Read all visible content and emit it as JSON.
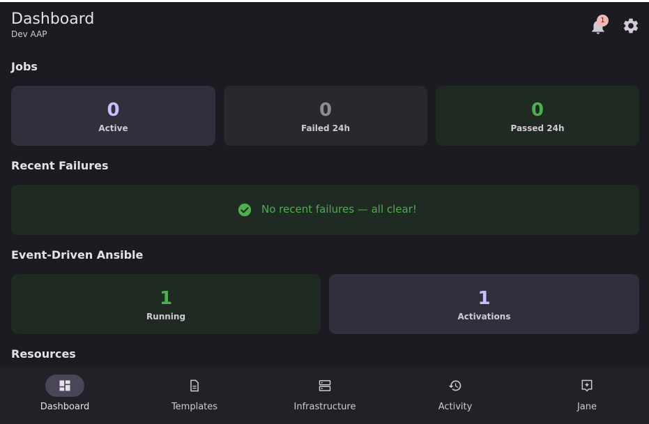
{
  "header": {
    "title": "Dashboard",
    "subtitle": "Dev AAP",
    "notification_count": "1"
  },
  "jobs": {
    "section_title": "Jobs",
    "cards": [
      {
        "value": "0",
        "label": "Active"
      },
      {
        "value": "0",
        "label": "Failed 24h"
      },
      {
        "value": "0",
        "label": "Passed 24h"
      }
    ]
  },
  "recent_failures": {
    "section_title": "Recent Failures",
    "message": "No recent failures — all clear!"
  },
  "eda": {
    "section_title": "Event-Driven Ansible",
    "cards": [
      {
        "value": "1",
        "label": "Running"
      },
      {
        "value": "1",
        "label": "Activations"
      }
    ]
  },
  "resources": {
    "section_title": "Resources"
  },
  "bottom_nav": {
    "items": [
      {
        "label": "Dashboard",
        "icon": "dashboard-icon",
        "active": true
      },
      {
        "label": "Templates",
        "icon": "document-icon",
        "active": false
      },
      {
        "label": "Infrastructure",
        "icon": "server-icon",
        "active": false
      },
      {
        "label": "Activity",
        "icon": "history-icon",
        "active": false
      },
      {
        "label": "Jane",
        "icon": "user-badge-icon",
        "active": false
      }
    ]
  },
  "colors": {
    "background": "#1c1b21",
    "accent_purple": "#cbbcff",
    "success_green": "#4caf50",
    "badge": "#f2b8b5"
  }
}
